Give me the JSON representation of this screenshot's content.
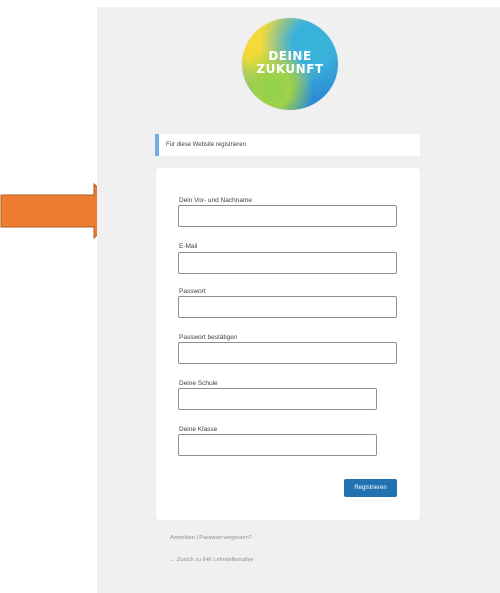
{
  "logo": {
    "line1": "DEINE",
    "line2": "ZUKUNFT"
  },
  "notice": {
    "text": "Für diese Website registrieren"
  },
  "fields": [
    {
      "label": "Dein Vor- und Nachname",
      "value": ""
    },
    {
      "label": "E-Mail",
      "value": ""
    },
    {
      "label": "Passwort",
      "value": ""
    },
    {
      "label": "Passwort bestätigen",
      "value": ""
    },
    {
      "label": "Deine Schule",
      "value": ""
    },
    {
      "label": "Deine Klasse",
      "value": ""
    }
  ],
  "submit": {
    "label": "Registrieren"
  },
  "links": {
    "login": "Anmelden",
    "separator": "|",
    "lost_password": "Passwort vergessen?",
    "back": "← Zurück zu IHK Lehrstellenrallye"
  },
  "colors": {
    "arrow_fill": "#ed7d31",
    "arrow_stroke": "#ae5a21",
    "button": "#2271b1",
    "notice_accent": "#72aee6"
  }
}
